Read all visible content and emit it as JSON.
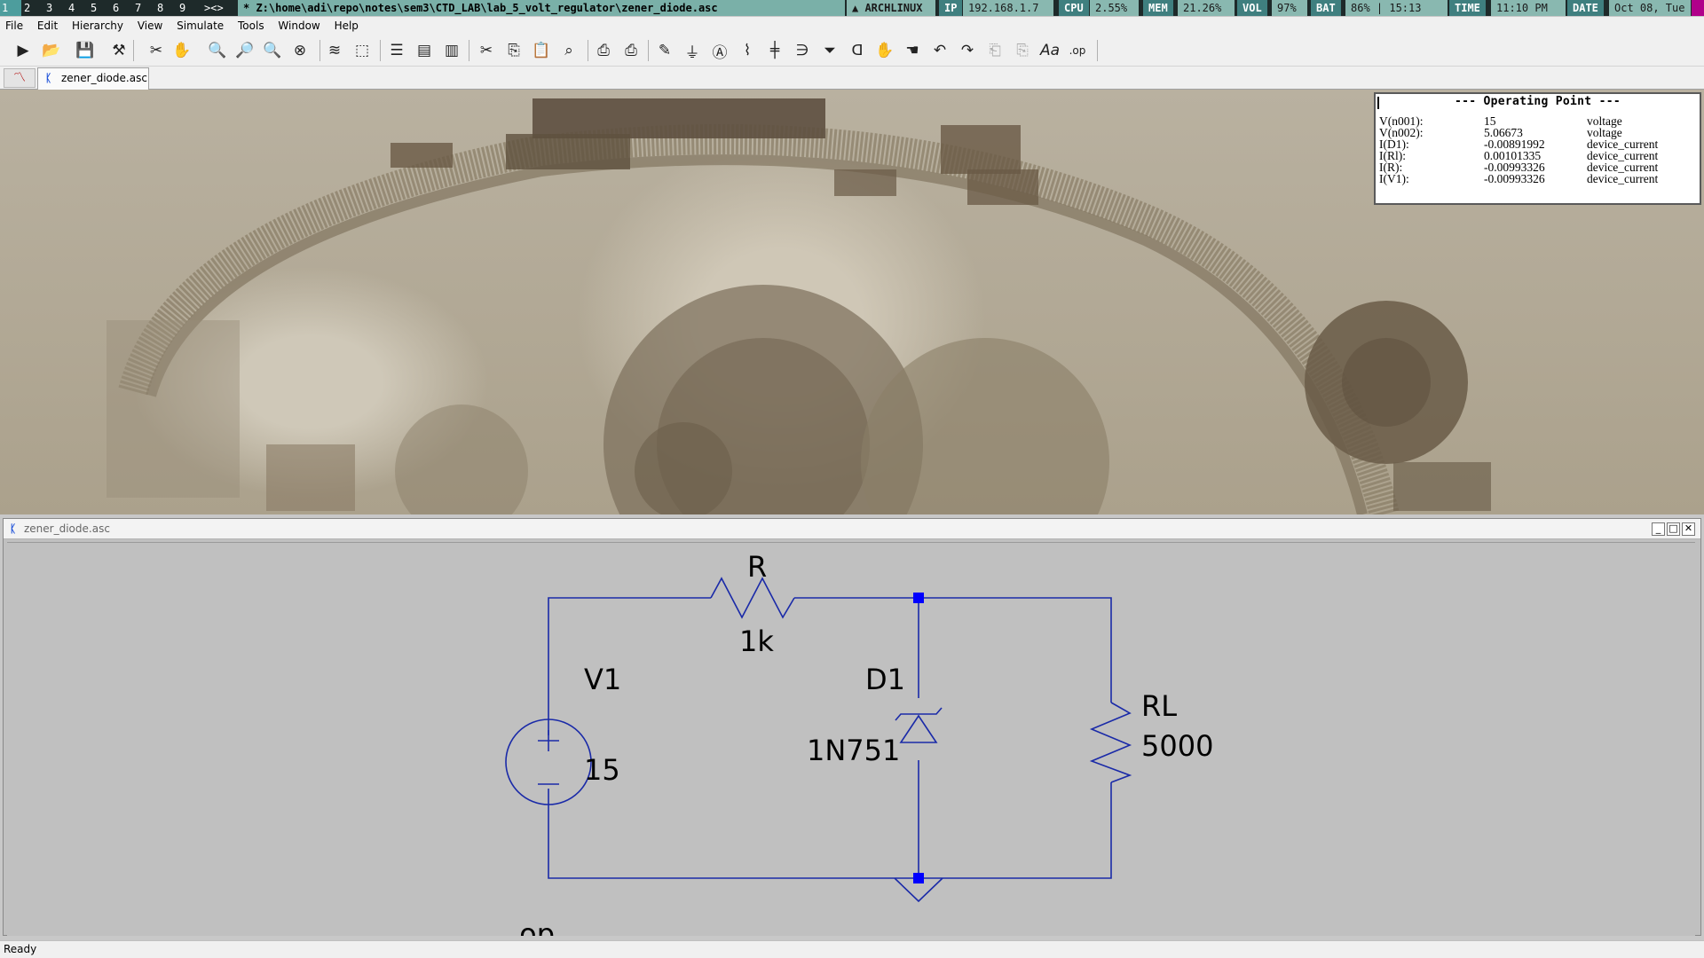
{
  "statusbar": {
    "workspaces": [
      "1",
      "2",
      "3",
      "4",
      "5",
      "6",
      "7",
      "8",
      "9",
      "><>"
    ],
    "window_title": "* Z:\\home\\adi\\repo\\notes\\sem3\\CTD_LAB\\lab_5_volt_regulator\\zener_diode.asc",
    "os": "ARCHLINUX",
    "ip_label": "IP",
    "ip_value": "192.168.1.7",
    "cpu_label": "CPU",
    "cpu_value": "2.55%",
    "mem_label": "MEM",
    "mem_value": "21.26%",
    "vol_label": "VOL",
    "vol_value": "97%",
    "bat_label": "BAT",
    "bat_value": "86% | 15:13",
    "time_label": "TIME",
    "time_value": "11:10 PM",
    "date_label": "DATE",
    "date_value": "Oct 08, Tue"
  },
  "menu": [
    "File",
    "Edit",
    "Hierarchy",
    "View",
    "Simulate",
    "Tools",
    "Window",
    "Help"
  ],
  "tabs": {
    "doc_label": "zener_diode.asc"
  },
  "operating_point": {
    "title": "--- Operating Point ---",
    "rows": [
      {
        "name": "V(n001):",
        "value": "15",
        "type": "voltage"
      },
      {
        "name": "V(n002):",
        "value": "5.06673",
        "type": "voltage"
      },
      {
        "name": "I(D1):",
        "value": "-0.00891992",
        "type": "device_current"
      },
      {
        "name": "I(Rl):",
        "value": "0.00101335",
        "type": "device_current"
      },
      {
        "name": "I(R):",
        "value": "-0.00993326",
        "type": "device_current"
      },
      {
        "name": "I(V1):",
        "value": "-0.00993326",
        "type": "device_current"
      }
    ]
  },
  "schematic": {
    "window_title": "zener_diode.asc",
    "r_name": "R",
    "r_value": "1k",
    "v_name": "V1",
    "v_value": "15",
    "d_name": "D1",
    "d_value": "1N751",
    "rl_name": "RL",
    "rl_value": "5000",
    "directive": ".op"
  },
  "status": {
    "text": "Ready"
  },
  "colors": {
    "wire": "#1a2aa8",
    "junction": "#0000ff",
    "canvas": "#c0c0c0",
    "titlebar_accent": "#7ab0a8"
  }
}
